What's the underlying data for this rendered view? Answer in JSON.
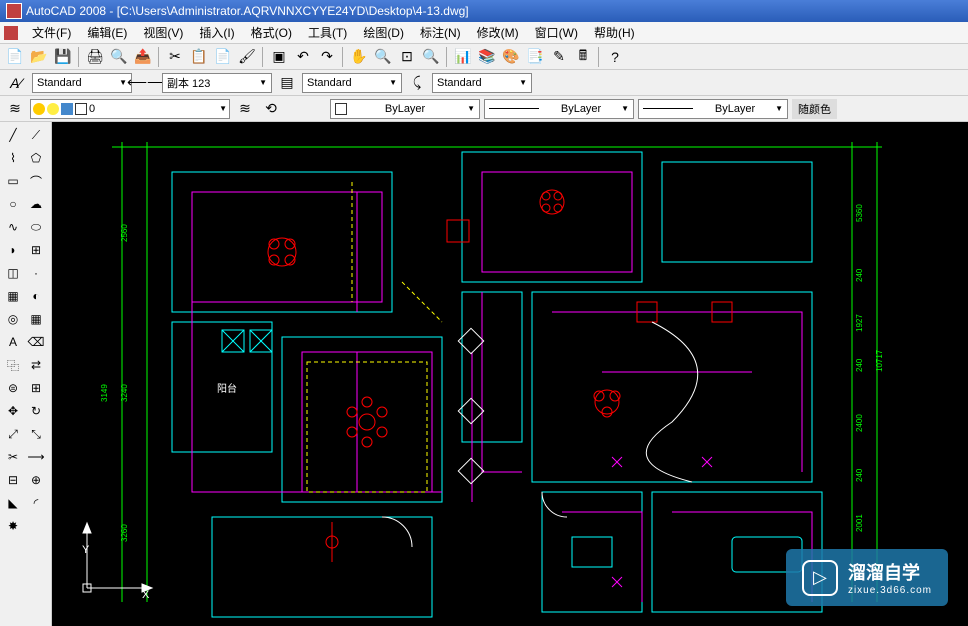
{
  "title": "AutoCAD 2008 - [C:\\Users\\Administrator.AQRVNNXCYYE24YD\\Desktop\\4-13.dwg]",
  "menu": {
    "file": "文件(F)",
    "edit": "编辑(E)",
    "view": "视图(V)",
    "insert": "插入(I)",
    "format": "格式(O)",
    "tools": "工具(T)",
    "draw": "绘图(D)",
    "dimension": "标注(N)",
    "modify": "修改(M)",
    "window": "窗口(W)",
    "help": "帮助(H)"
  },
  "styles": {
    "text_style": "Standard",
    "dim_style": "副本 123",
    "table_style": "Standard",
    "mleader_style": "Standard"
  },
  "layers": {
    "current": "0",
    "color_label": "ByLayer",
    "linetype_label": "ByLayer",
    "lineweight_label": "ByLayer",
    "color_random": "随颜色"
  },
  "dimensions": {
    "d1": "2560",
    "d2": "3149",
    "d3": "3240",
    "d4": "3260",
    "d5": "5360",
    "d6": "240",
    "d7": "1927",
    "d8": "240",
    "d9": "10717",
    "d10": "2400",
    "d11": "240",
    "d12": "2001",
    "room_label": "阳台"
  },
  "ucs": {
    "x": "X",
    "y": "Y"
  },
  "watermark": {
    "title": "溜溜自学",
    "url": "zixue.3d66.com"
  }
}
